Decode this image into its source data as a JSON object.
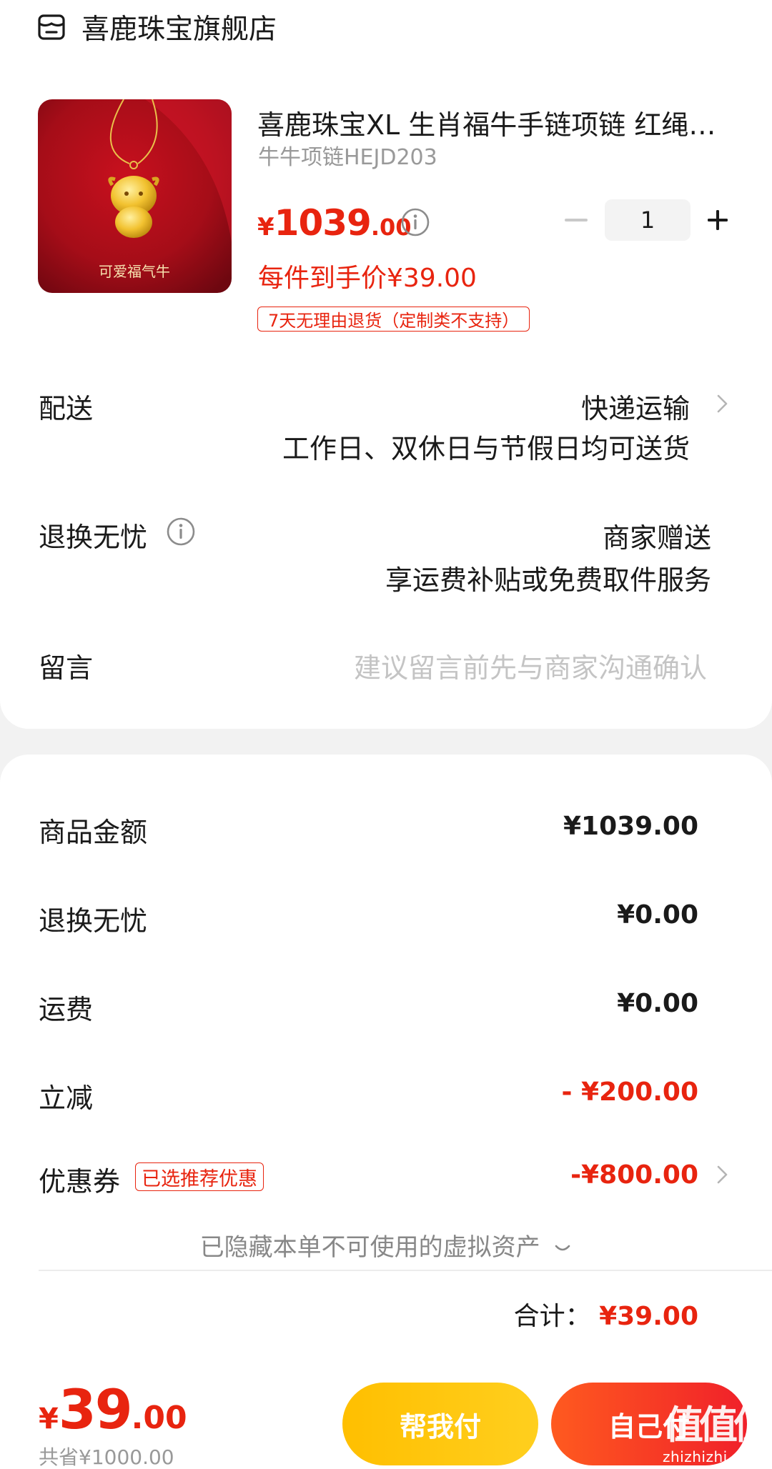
{
  "store": {
    "name": "喜鹿珠宝旗舰店",
    "icon": "store-icon"
  },
  "product": {
    "title": "喜鹿珠宝XL 生肖福牛手链项链 红绳手链 足金",
    "sku": "牛牛项链HEJD203",
    "image_caption": "可爱福气牛",
    "price_yen": "¥",
    "price_int": "1039",
    "price_dec": ".00",
    "quantity": "1",
    "unit_price": "每件到手价¥39.00",
    "return_tag": "7天无理由退货（定制类不支持）"
  },
  "delivery": {
    "label": "配送",
    "method": "快递运输",
    "note": "工作日、双休日与节假日均可送货"
  },
  "worry_free": {
    "label": "退换无忧",
    "value": "商家赠送",
    "note": "享运费补贴或免费取件服务"
  },
  "message": {
    "label": "留言",
    "placeholder": "建议留言前先与商家沟通确认"
  },
  "summary": {
    "goods_label": "商品金额",
    "goods_value": "¥1039.00",
    "worry_label": "退换无忧",
    "worry_value": "¥0.00",
    "shipping_label": "运费",
    "shipping_value": "¥0.00",
    "discount_label": "立减",
    "discount_value": "- ¥200.00",
    "coupon_label": "优惠券",
    "coupon_tag": "已选推荐优惠",
    "coupon_value": "-¥800.00",
    "hidden_assets": "已隐藏本单不可使用的虚拟资产",
    "total_label": "合计：",
    "total_value": "¥39.00"
  },
  "bottom": {
    "yen": "¥",
    "int": "39",
    "dec": ".00",
    "saved": "共省¥1000.00",
    "help_pay": "帮我付",
    "self_pay": "自己付"
  },
  "watermark": {
    "glyphs": "值值值",
    "url": "zhizhizhi.com"
  },
  "colors": {
    "accent_red": "#e8240f",
    "help_btn": "#ffc107",
    "self_btn": "#f5302a"
  }
}
